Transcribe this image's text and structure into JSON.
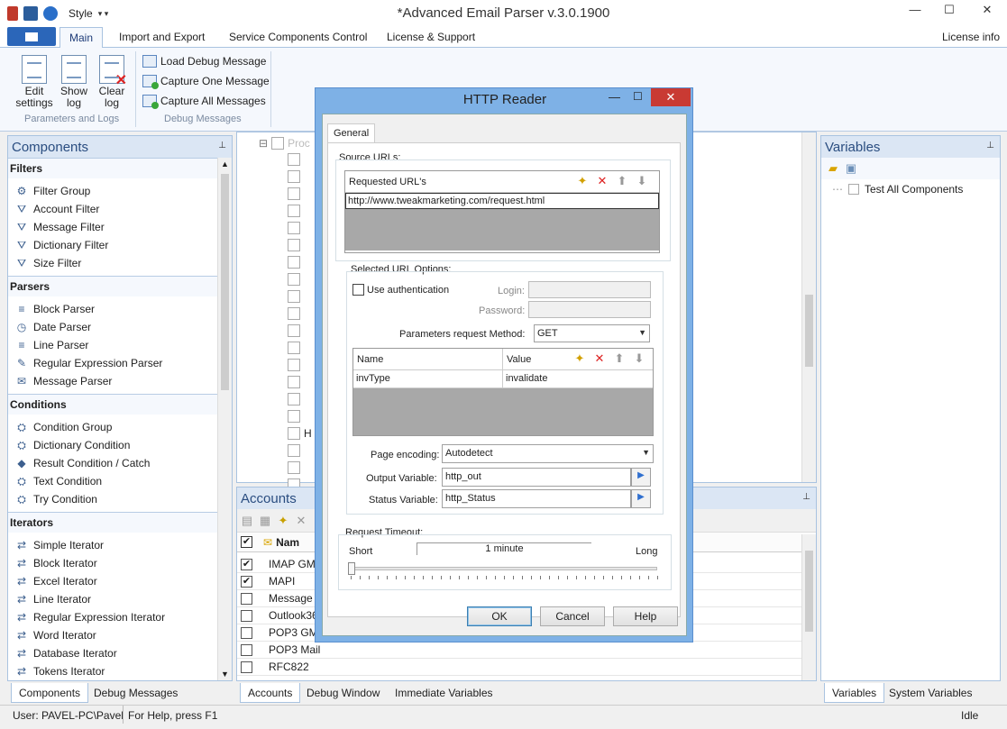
{
  "window": {
    "title": "*Advanced Email Parser v.3.0.1900",
    "style_label": "Style"
  },
  "ribbon": {
    "tabs": [
      "Main",
      "Import and Export",
      "Service Components Control",
      "License & Support"
    ],
    "license_info": "License info",
    "big_buttons": [
      {
        "label": "Edit settings",
        "l1": "Edit",
        "l2": "settings"
      },
      {
        "label": "Show log",
        "l1": "Show",
        "l2": "log"
      },
      {
        "label": "Clear log",
        "l1": "Clear",
        "l2": "log"
      }
    ],
    "group1_caption": "Parameters and Logs",
    "small_buttons": [
      "Load Debug Message",
      "Capture One Message",
      "Capture All Messages"
    ],
    "group2_caption": "Debug Messages"
  },
  "components": {
    "title": "Components",
    "sections": [
      {
        "name": "Filters",
        "items": [
          "Filter Group",
          "Account Filter",
          "Message Filter",
          "Dictionary Filter",
          "Size Filter"
        ]
      },
      {
        "name": "Parsers",
        "items": [
          "Block Parser",
          "Date Parser",
          "Line Parser",
          "Regular Expression Parser",
          "Message Parser"
        ]
      },
      {
        "name": "Conditions",
        "items": [
          "Condition Group",
          "Dictionary Condition",
          "Result Condition / Catch",
          "Text Condition",
          "Try Condition"
        ]
      },
      {
        "name": "Iterators",
        "items": [
          "Simple Iterator",
          "Block Iterator",
          "Excel Iterator",
          "Line Iterator",
          "Regular Expression Iterator",
          "Word Iterator",
          "Database Iterator",
          "Tokens Iterator"
        ]
      }
    ],
    "tabs": [
      "Components",
      "Debug Messages"
    ]
  },
  "tree": {
    "root_label": "Proc",
    "hidden_label": "H"
  },
  "accounts": {
    "title": "Accounts",
    "column_name": "Nam",
    "rows": [
      {
        "name": "IMAP GM",
        "checked": true
      },
      {
        "name": "MAPI",
        "checked": true
      },
      {
        "name": "Message T",
        "checked": false
      },
      {
        "name": "Outlook36",
        "checked": false
      },
      {
        "name": "POP3 GM",
        "checked": false
      },
      {
        "name": "POP3 Mail",
        "checked": false
      },
      {
        "name": "RFC822",
        "checked": false
      }
    ],
    "tabs": [
      "Accounts",
      "Debug Window",
      "Immediate Variables"
    ]
  },
  "variables": {
    "title": "Variables",
    "items": [
      "Test All Components"
    ],
    "tabs": [
      "Variables",
      "System Variables"
    ]
  },
  "status": {
    "user": "User: PAVEL-PC\\Pavel",
    "help": "For Help, press F1",
    "state": "Idle"
  },
  "dialog": {
    "title": "HTTP Reader",
    "tab": "General",
    "source_urls_label": "Source URLs:",
    "requested_urls_header": "Requested URL's",
    "url_value": "http://www.tweakmarketing.com/request.html",
    "selected_options_label": "Selected URL Options:",
    "use_auth_label": "Use authentication",
    "login_label": "Login:",
    "password_label": "Password:",
    "method_label": "Parameters request Method:",
    "method_value": "GET",
    "param_headers": [
      "Name",
      "Value"
    ],
    "params": [
      {
        "name": "invType",
        "value": "invalidate"
      }
    ],
    "encoding_label": "Page encoding:",
    "encoding_value": "Autodetect",
    "output_label": "Output Variable:",
    "output_value": "http_out",
    "status_label": "Status Variable:",
    "status_value": "http_Status",
    "timeout_label": "Request Timeout:",
    "timeout_short": "Short",
    "timeout_long": "Long",
    "timeout_value": "1 minute",
    "ok": "OK",
    "cancel": "Cancel",
    "help": "Help"
  }
}
